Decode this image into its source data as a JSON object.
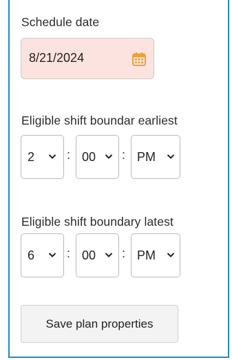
{
  "schedule": {
    "label": "Schedule date",
    "value": "8/21/2024",
    "calendar_icon": "calendar-icon",
    "field_background": "#fde3df",
    "icon_color": "#f0a030"
  },
  "earliest": {
    "label": "Eligible shift boundar earliest",
    "hour": "2",
    "minute": "00",
    "ampm": "PM",
    "separator": ":"
  },
  "latest": {
    "label": "Eligible shift boundary latest",
    "hour": "6",
    "minute": "00",
    "ampm": "PM",
    "separator": ":"
  },
  "actions": {
    "save_label": "Save plan properties"
  },
  "colors": {
    "panel_border": "#1e88d0"
  }
}
